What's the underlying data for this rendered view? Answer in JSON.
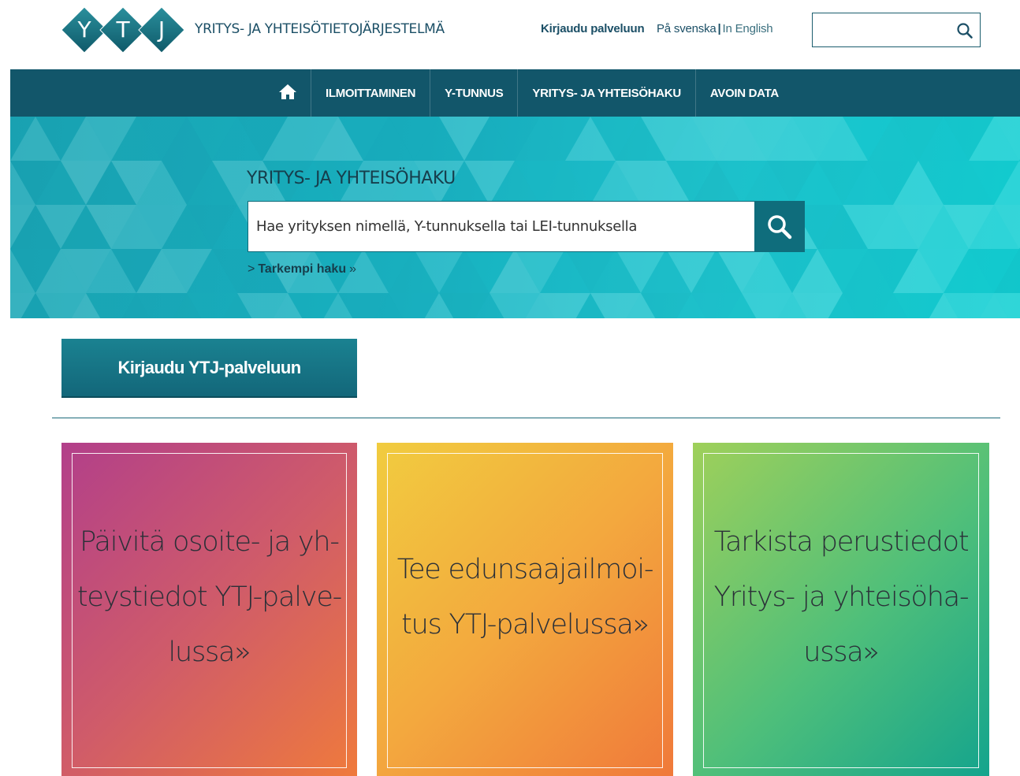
{
  "header": {
    "logo_letters": [
      "Y",
      "T",
      "J"
    ],
    "site_name": "YRITYS- JA YHTEISÖTIETOJÄRJESTELMÄ",
    "login_link": "Kirjaudu palveluun",
    "lang_sv": "På svenska",
    "lang_separator": "|",
    "lang_en": "In English",
    "search_placeholder": "",
    "search_icon": "search-icon"
  },
  "nav": {
    "home_icon": "home-icon",
    "items": [
      "ILMOITTAMINEN",
      "Y-TUNNUS",
      "YRITYS- JA YHTEISÖHAKU",
      "AVOIN DATA"
    ]
  },
  "hero": {
    "title": "YRITYS- JA YHTEISÖHAKU",
    "search_placeholder": "Hae yrityksen nimellä, Y-tunnuksella tai LEI-tunnuksella",
    "advanced_search": "Tarkempi haku",
    "advanced_chevron": ">",
    "advanced_double_chevron": "»"
  },
  "login_button": "Kirjaudu YTJ-palveluun",
  "cards": [
    {
      "text": "Päivitä osoite- ja yh-teystiedot YTJ-palve-lussa»"
    },
    {
      "text": "Tee edunsaajailmoi-tus YTJ-palvelussa»"
    },
    {
      "text": "Tarkista perustiedot Yritys- ja yhteisöha-ussa»"
    }
  ],
  "colors": {
    "brand_dark": "#12566a",
    "brand_teal": "#0f6d7c",
    "hero_cyan": "#19b3c2"
  }
}
